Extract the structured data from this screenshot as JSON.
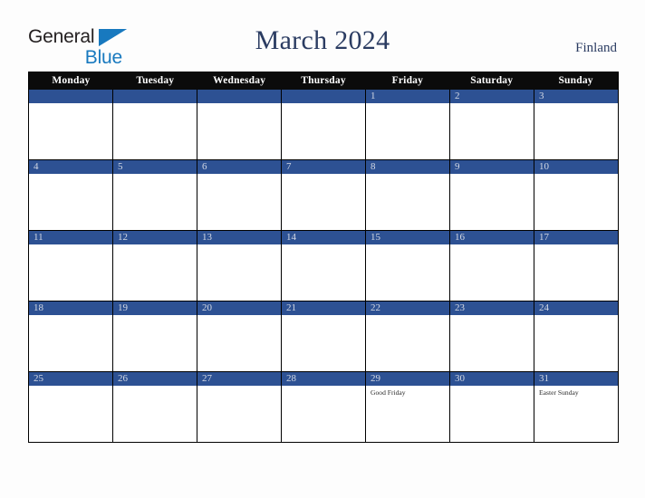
{
  "brand": {
    "word1": "General",
    "word2": "Blue",
    "triangle_color": "#1879bf",
    "word1_color": "#231f20",
    "word2_color": "#1879bf"
  },
  "header": {
    "title": "March 2024",
    "country": "Finland",
    "title_color": "#2b3c62"
  },
  "calendar": {
    "weekdays": [
      "Monday",
      "Tuesday",
      "Wednesday",
      "Thursday",
      "Friday",
      "Saturday",
      "Sunday"
    ],
    "header_bg": "#0b0b0b",
    "date_bar_color": "#2d5193",
    "date_text_color": "#d4d9e4",
    "weeks": [
      [
        {
          "date": "",
          "events": []
        },
        {
          "date": "",
          "events": []
        },
        {
          "date": "",
          "events": []
        },
        {
          "date": "",
          "events": []
        },
        {
          "date": "1",
          "events": []
        },
        {
          "date": "2",
          "events": []
        },
        {
          "date": "3",
          "events": []
        }
      ],
      [
        {
          "date": "4",
          "events": []
        },
        {
          "date": "5",
          "events": []
        },
        {
          "date": "6",
          "events": []
        },
        {
          "date": "7",
          "events": []
        },
        {
          "date": "8",
          "events": []
        },
        {
          "date": "9",
          "events": []
        },
        {
          "date": "10",
          "events": []
        }
      ],
      [
        {
          "date": "11",
          "events": []
        },
        {
          "date": "12",
          "events": []
        },
        {
          "date": "13",
          "events": []
        },
        {
          "date": "14",
          "events": []
        },
        {
          "date": "15",
          "events": []
        },
        {
          "date": "16",
          "events": []
        },
        {
          "date": "17",
          "events": []
        }
      ],
      [
        {
          "date": "18",
          "events": []
        },
        {
          "date": "19",
          "events": []
        },
        {
          "date": "20",
          "events": []
        },
        {
          "date": "21",
          "events": []
        },
        {
          "date": "22",
          "events": []
        },
        {
          "date": "23",
          "events": []
        },
        {
          "date": "24",
          "events": []
        }
      ],
      [
        {
          "date": "25",
          "events": []
        },
        {
          "date": "26",
          "events": []
        },
        {
          "date": "27",
          "events": []
        },
        {
          "date": "28",
          "events": []
        },
        {
          "date": "29",
          "events": [
            "Good Friday"
          ]
        },
        {
          "date": "30",
          "events": []
        },
        {
          "date": "31",
          "events": [
            "Easter Sunday"
          ]
        }
      ]
    ]
  }
}
